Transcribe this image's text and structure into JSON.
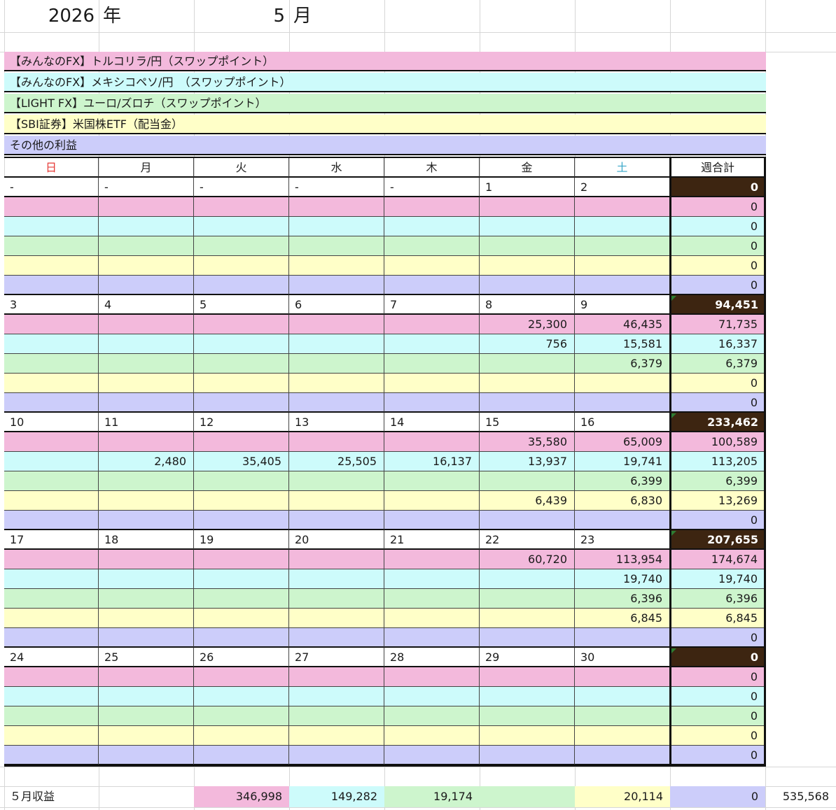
{
  "header": {
    "year": "2026",
    "year_unit": "年",
    "month": "5",
    "month_unit": "月"
  },
  "legend": [
    {
      "label": "【みんなのFX】トルコリラ/円（スワップポイント）",
      "color": "#f3b9dc"
    },
    {
      "label": "【みんなのFX】メキシコペソ/円　（スワップポイント）",
      "color": "#cdfbfb"
    },
    {
      "label": "【LIGHT FX】ユーロ/ズロチ（スワップポイント）",
      "color": "#cdf5cd"
    },
    {
      "label": "【SBI証券】米国株ETF（配当金）",
      "color": "#ffffc8"
    },
    {
      "label": "その他の利益",
      "color": "#cccdfa"
    }
  ],
  "weekday_header": [
    "日",
    "月",
    "火",
    "水",
    "木",
    "金",
    "土"
  ],
  "weekday_colors": [
    "#e53935",
    "#222222",
    "#222222",
    "#222222",
    "#222222",
    "#222222",
    "#39a7c9"
  ],
  "weekly_total_header": "週合計",
  "weeks": [
    {
      "dates": [
        "-",
        "-",
        "-",
        "-",
        "-",
        "1",
        "2"
      ],
      "total": "0",
      "rows": [
        [
          "",
          "",
          "",
          "",
          "",
          "",
          "",
          "0"
        ],
        [
          "",
          "",
          "",
          "",
          "",
          "",
          "",
          "0"
        ],
        [
          "",
          "",
          "",
          "",
          "",
          "",
          "",
          "0"
        ],
        [
          "",
          "",
          "",
          "",
          "",
          "",
          "",
          "0"
        ],
        [
          "",
          "",
          "",
          "",
          "",
          "",
          "",
          "0"
        ]
      ]
    },
    {
      "dates": [
        "3",
        "4",
        "5",
        "6",
        "7",
        "8",
        "9"
      ],
      "total": "94,451",
      "rows": [
        [
          "",
          "",
          "",
          "",
          "",
          "25,300",
          "46,435",
          "71,735"
        ],
        [
          "",
          "",
          "",
          "",
          "",
          "756",
          "15,581",
          "16,337"
        ],
        [
          "",
          "",
          "",
          "",
          "",
          "",
          "6,379",
          "6,379"
        ],
        [
          "",
          "",
          "",
          "",
          "",
          "",
          "",
          "0"
        ],
        [
          "",
          "",
          "",
          "",
          "",
          "",
          "",
          "0"
        ]
      ]
    },
    {
      "dates": [
        "10",
        "11",
        "12",
        "13",
        "14",
        "15",
        "16"
      ],
      "total": "233,462",
      "rows": [
        [
          "",
          "",
          "",
          "",
          "",
          "35,580",
          "65,009",
          "100,589"
        ],
        [
          "",
          "2,480",
          "35,405",
          "25,505",
          "16,137",
          "13,937",
          "19,741",
          "113,205"
        ],
        [
          "",
          "",
          "",
          "",
          "",
          "",
          "6,399",
          "6,399"
        ],
        [
          "",
          "",
          "",
          "",
          "",
          "6,439",
          "6,830",
          "13,269"
        ],
        [
          "",
          "",
          "",
          "",
          "",
          "",
          "",
          "0"
        ]
      ]
    },
    {
      "dates": [
        "17",
        "18",
        "19",
        "20",
        "21",
        "22",
        "23"
      ],
      "total": "207,655",
      "rows": [
        [
          "",
          "",
          "",
          "",
          "",
          "60,720",
          "113,954",
          "174,674"
        ],
        [
          "",
          "",
          "",
          "",
          "",
          "",
          "19,740",
          "19,740"
        ],
        [
          "",
          "",
          "",
          "",
          "",
          "",
          "6,396",
          "6,396"
        ],
        [
          "",
          "",
          "",
          "",
          "",
          "",
          "6,845",
          "6,845"
        ],
        [
          "",
          "",
          "",
          "",
          "",
          "",
          "",
          "0"
        ]
      ]
    },
    {
      "dates": [
        "24",
        "25",
        "26",
        "27",
        "28",
        "29",
        "30"
      ],
      "total": "0",
      "rows": [
        [
          "",
          "",
          "",
          "",
          "",
          "",
          "",
          "0"
        ],
        [
          "",
          "",
          "",
          "",
          "",
          "",
          "",
          "0"
        ],
        [
          "",
          "",
          "",
          "",
          "",
          "",
          "",
          "0"
        ],
        [
          "",
          "",
          "",
          "",
          "",
          "",
          "",
          "0"
        ],
        [
          "",
          "",
          "",
          "",
          "",
          "",
          "",
          "0"
        ]
      ]
    }
  ],
  "summary": {
    "label": "５月収益",
    "values": [
      "346,998",
      "149,282",
      "19,174",
      "20,114",
      "0"
    ],
    "grand_total": "535,568"
  },
  "colors": {
    "week_total_bg": "#3d2511",
    "week_total_fg": "#ffffff",
    "border": "#111111"
  }
}
